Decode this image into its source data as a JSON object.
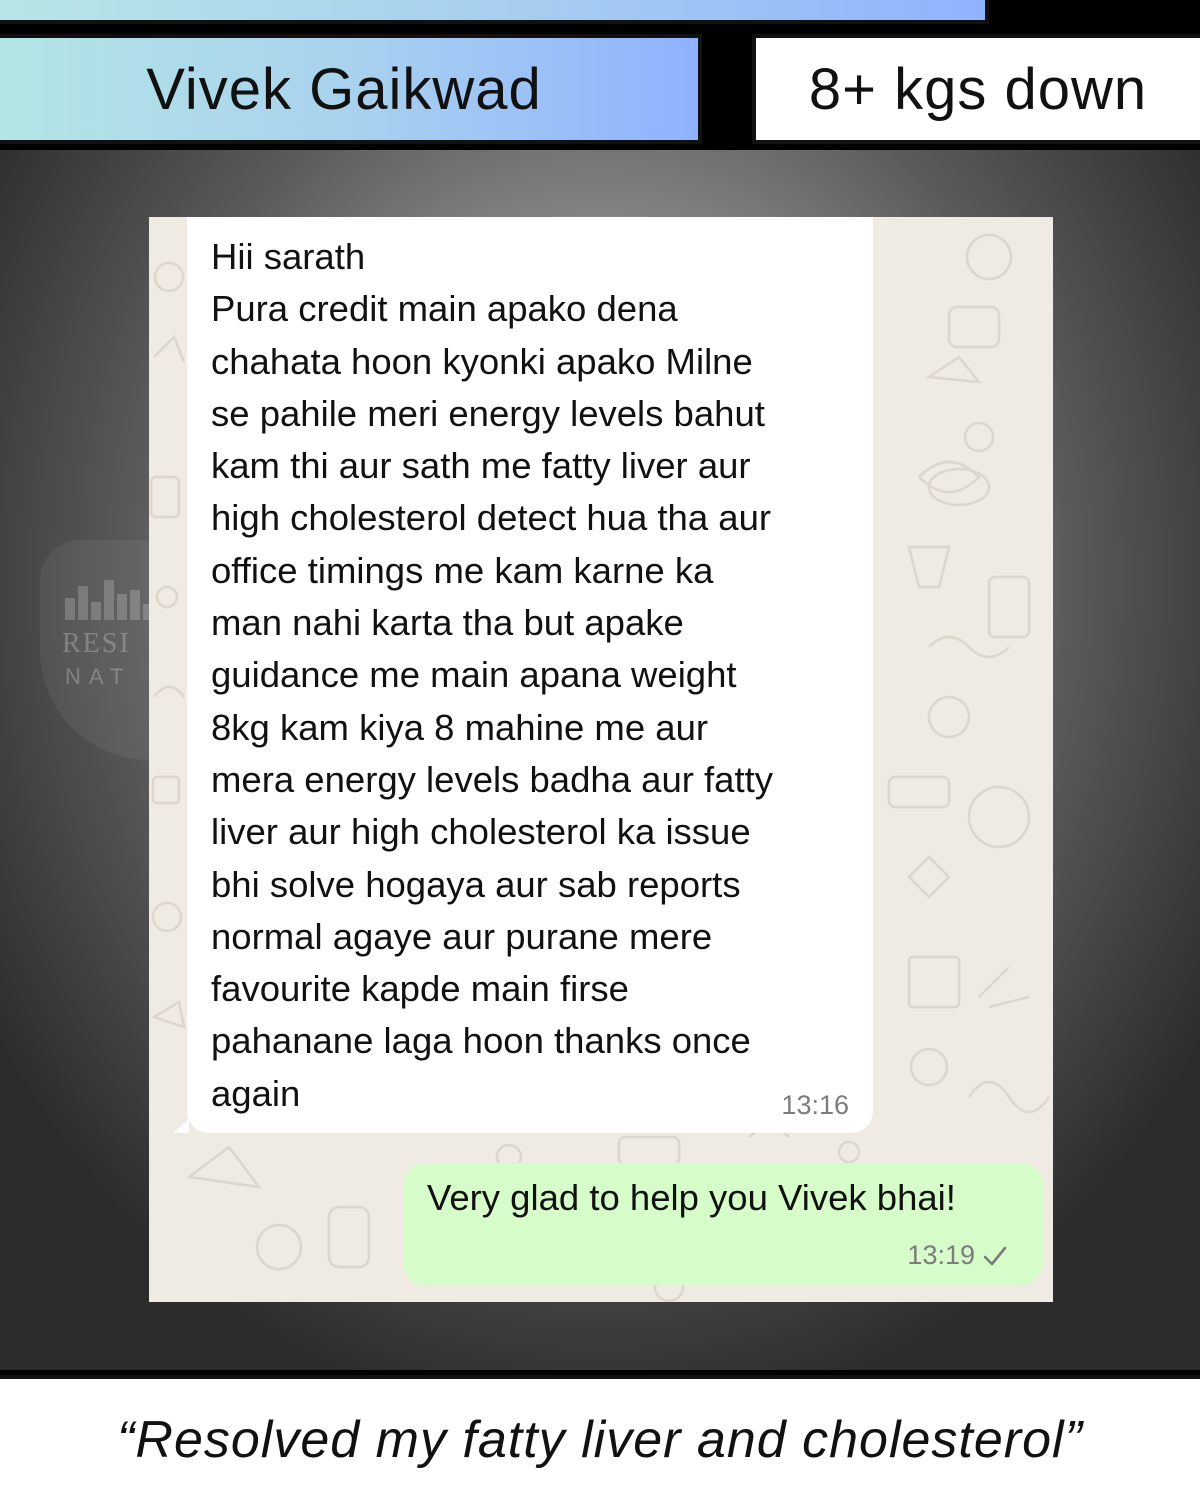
{
  "header": {
    "name": "Vivek Gaikwad",
    "result": "8+ kgs down"
  },
  "chat": {
    "incoming": {
      "text": "Hii sarath\nPura credit main apako dena\nchahata hoon kyonki apako Milne\nse pahile meri energy levels bahut\nkam thi aur sath me fatty liver aur\nhigh cholesterol detect hua tha aur\noffice timings me kam karne ka\nman nahi karta tha but apake\nguidance me main apana weight\n8kg kam kiya 8 mahine me aur\nmera energy levels badha aur fatty\nliver aur high cholesterol ka issue\nbhi solve hogaya aur sab reports\nnormal agaye aur purane mere\nfavourite kapde main firse\npahanane laga hoon thanks once\nagain",
      "time": "13:16"
    },
    "outgoing": {
      "text": "Very glad to help you Vivek bhai!",
      "time": "13:19",
      "status_icon": "single-check-icon"
    },
    "colors": {
      "background": "#efeae2",
      "incoming_bubble": "#ffffff",
      "outgoing_bubble": "#d6fdc9"
    }
  },
  "watermark": {
    "line1": "RESI",
    "line2": "NAT"
  },
  "footer": {
    "quote": "“Resolved my fatty liver and cholesterol”"
  }
}
